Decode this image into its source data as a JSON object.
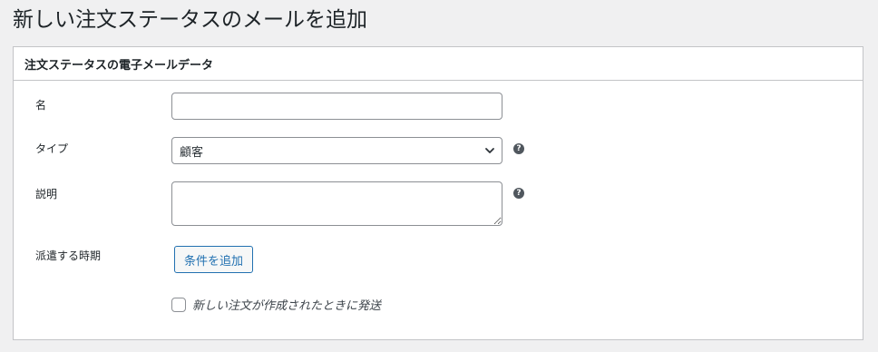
{
  "page": {
    "title": "新しい注文ステータスのメールを追加"
  },
  "panel": {
    "title": "注文ステータスの電子メールデータ"
  },
  "fields": {
    "name": {
      "label": "名",
      "value": ""
    },
    "type": {
      "label": "タイプ",
      "selected": "顧客"
    },
    "description": {
      "label": "説明",
      "value": ""
    },
    "timing": {
      "label": "派遣する時期",
      "button_label": "条件を追加"
    },
    "send_on_new_order": {
      "label": "新しい注文が作成されたときに発送",
      "checked": false
    }
  },
  "icons": {
    "help": "question-mark",
    "help_symbol": "?",
    "select_chevron": "chevron-down-icon"
  },
  "colors": {
    "background": "#f0f0f1",
    "panel_border": "#c3c4c7",
    "accent": "#2271b1",
    "help_icon": "#50575e"
  }
}
